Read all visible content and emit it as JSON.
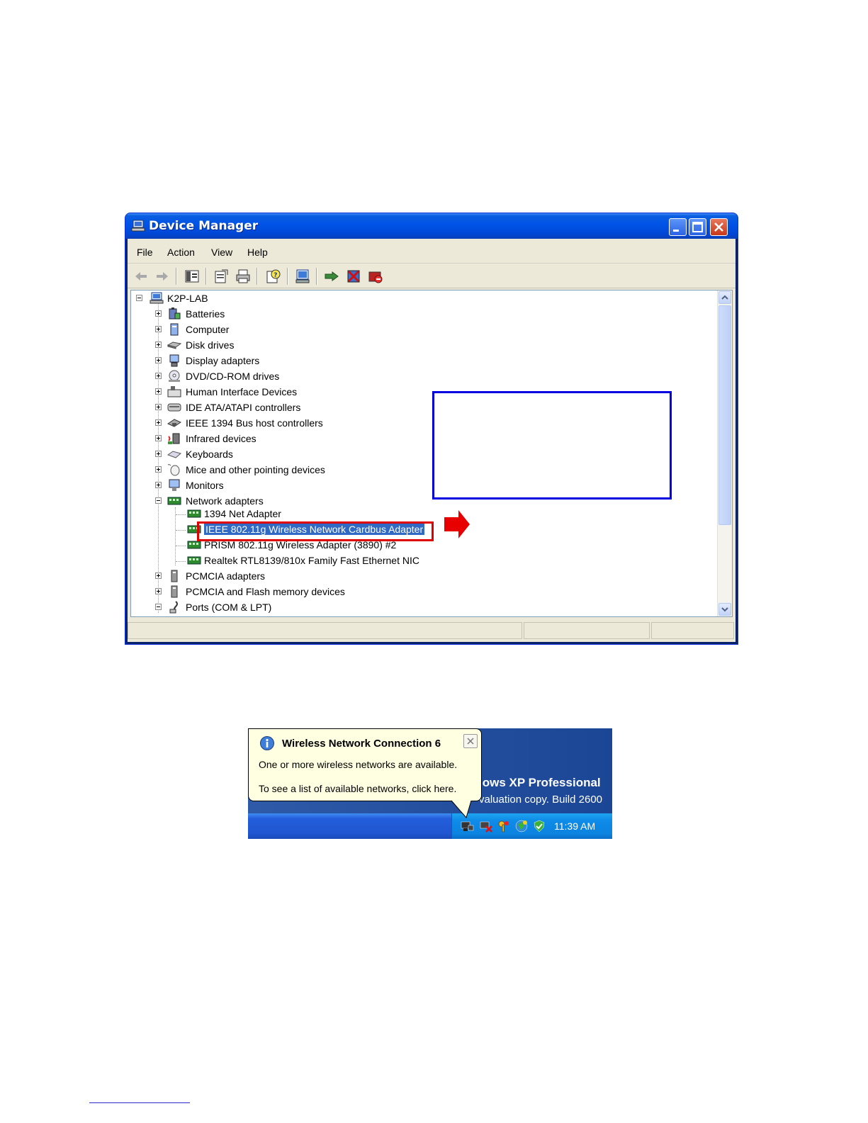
{
  "window": {
    "title": "Device Manager",
    "menu": [
      "File",
      "Action",
      "View",
      "Help"
    ]
  },
  "tree": {
    "root": "K2P-LAB",
    "items": [
      "Batteries",
      "Computer",
      "Disk drives",
      "Display adapters",
      "DVD/CD-ROM drives",
      "Human Interface Devices",
      "IDE ATA/ATAPI controllers",
      "IEEE 1394 Bus host controllers",
      "Infrared devices",
      "Keyboards",
      "Mice and other pointing devices",
      "Monitors",
      "Network adapters",
      "PCMCIA adapters",
      "PCMCIA and Flash memory devices",
      "Ports (COM & LPT)"
    ],
    "network_children": [
      "1394 Net Adapter",
      "IEEE 802.11g Wireless Network Cardbus Adapter",
      "PRISM 802.11g Wireless Adapter (3890) #2",
      "Realtek RTL8139/810x Family Fast Ethernet NIC"
    ],
    "selected": "IEEE 802.11g Wireless Network Cardbus Adapter"
  },
  "colors": {
    "highlight_box": "#e00000",
    "callout_box": "#0000e0",
    "selection": "#316ac5"
  },
  "balloon": {
    "title": "Wireless Network Connection 6",
    "line1": "One or more wireless networks are available.",
    "line2": "To see a list of available networks, click here."
  },
  "desktop": {
    "watermark_line1": "lows XP Professional",
    "watermark_line2": "valuation copy. Build 2600"
  },
  "tray": {
    "clock": "11:39 AM"
  }
}
